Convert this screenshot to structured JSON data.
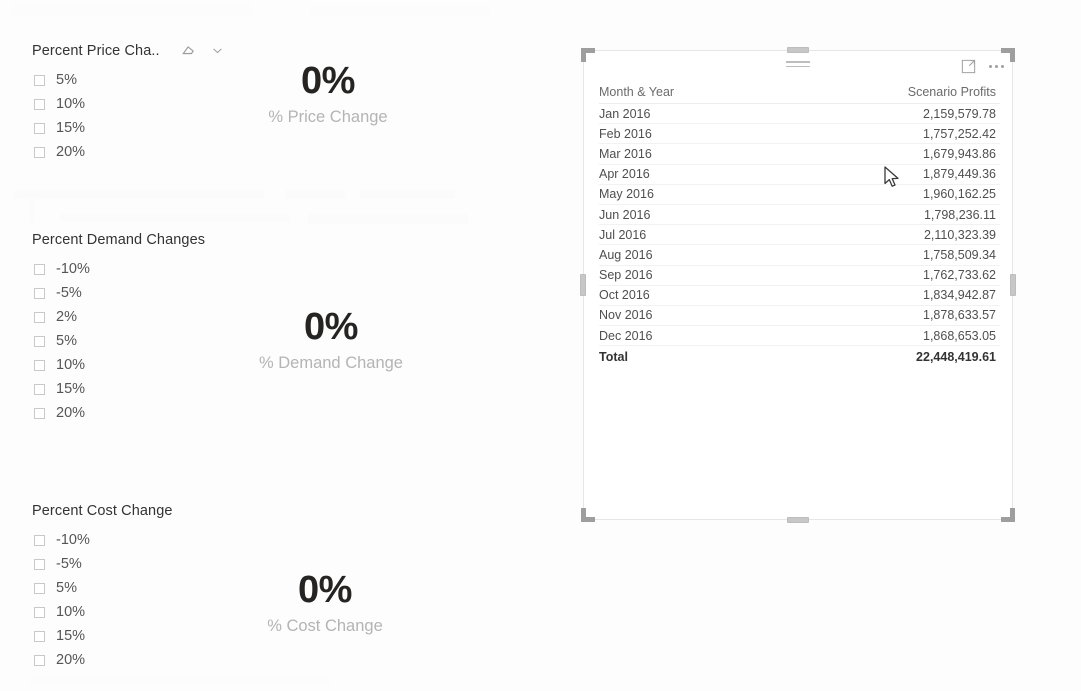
{
  "slicers": [
    {
      "id": "price",
      "title": "Percent Price Cha..",
      "clear_icon": "eraser-icon",
      "dropdown_icon": "chevron-down-icon",
      "items": [
        "5%",
        "10%",
        "15%",
        "20%"
      ]
    },
    {
      "id": "demand",
      "title": "Percent Demand Changes",
      "items": [
        "-10%",
        "-5%",
        "2%",
        "5%",
        "10%",
        "15%",
        "20%"
      ]
    },
    {
      "id": "cost",
      "title": "Percent Cost Change",
      "items": [
        "-10%",
        "-5%",
        "5%",
        "10%",
        "15%",
        "20%"
      ]
    }
  ],
  "kpis": [
    {
      "id": "price",
      "value": "0%",
      "label": "% Price Change"
    },
    {
      "id": "demand",
      "value": "0%",
      "label": "% Demand Change"
    },
    {
      "id": "cost",
      "value": "0%",
      "label": "% Cost Change"
    }
  ],
  "table_visual": {
    "focus_icon": "focus-mode-icon",
    "more_icon": "more-options-icon",
    "drag_icon": "drag-handle-icon",
    "columns": [
      "Month & Year",
      "Scenario Profits"
    ],
    "rows": [
      {
        "month": "Jan 2016",
        "profit": "2,159,579.78"
      },
      {
        "month": "Feb 2016",
        "profit": "1,757,252.42"
      },
      {
        "month": "Mar 2016",
        "profit": "1,679,943.86"
      },
      {
        "month": "Apr 2016",
        "profit": "1,879,449.36"
      },
      {
        "month": "May 2016",
        "profit": "1,960,162.25"
      },
      {
        "month": "Jun 2016",
        "profit": "1,798,236.11"
      },
      {
        "month": "Jul 2016",
        "profit": "2,110,323.39"
      },
      {
        "month": "Aug 2016",
        "profit": "1,758,509.34"
      },
      {
        "month": "Sep 2016",
        "profit": "1,762,733.62"
      },
      {
        "month": "Oct 2016",
        "profit": "1,834,942.87"
      },
      {
        "month": "Nov 2016",
        "profit": "1,878,633.57"
      },
      {
        "month": "Dec 2016",
        "profit": "1,868,653.05"
      }
    ],
    "total": {
      "label": "Total",
      "profit": "22,448,419.61"
    }
  },
  "colors": {
    "kpi_value": "#252423",
    "kpi_label": "#b4b4b4",
    "slicer_title": "#333333",
    "slicer_item": "#555555",
    "table_header": "#6b6b6b",
    "table_cell": "#4f4f4f",
    "selection": "#9e9e9e"
  }
}
